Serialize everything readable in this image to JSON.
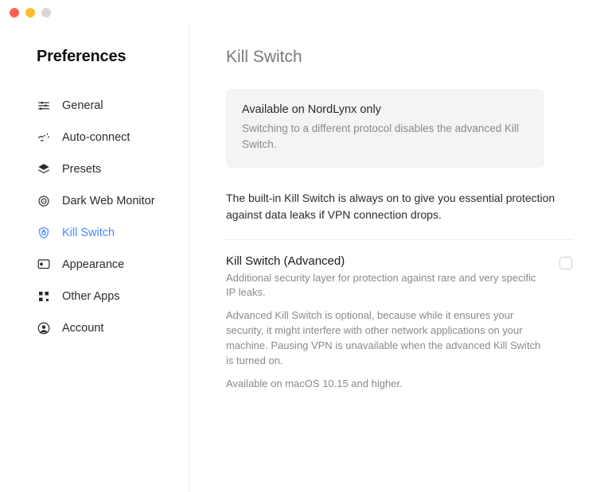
{
  "sidebar": {
    "title": "Preferences",
    "items": [
      {
        "label": "General"
      },
      {
        "label": "Auto-connect"
      },
      {
        "label": "Presets"
      },
      {
        "label": "Dark Web Monitor"
      },
      {
        "label": "Kill Switch"
      },
      {
        "label": "Appearance"
      },
      {
        "label": "Other Apps"
      },
      {
        "label": "Account"
      }
    ],
    "activeIndex": 4
  },
  "main": {
    "title": "Kill Switch",
    "infoBox": {
      "title": "Available on NordLynx only",
      "desc": "Switching to a different protocol disables the advanced Kill Switch."
    },
    "intro": "The built-in Kill Switch is always on to give you essential protection against data leaks if VPN connection drops.",
    "advanced": {
      "title": "Kill Switch (Advanced)",
      "sub": "Additional security layer for protection against rare and very specific IP leaks.",
      "desc": "Advanced Kill Switch is optional, because while it ensures your security, it might interfere with other network applications on your machine. Pausing VPN is unavailable when the advanced Kill Switch is turned on.",
      "note": "Available on macOS 10.15 and higher.",
      "checked": false
    }
  }
}
